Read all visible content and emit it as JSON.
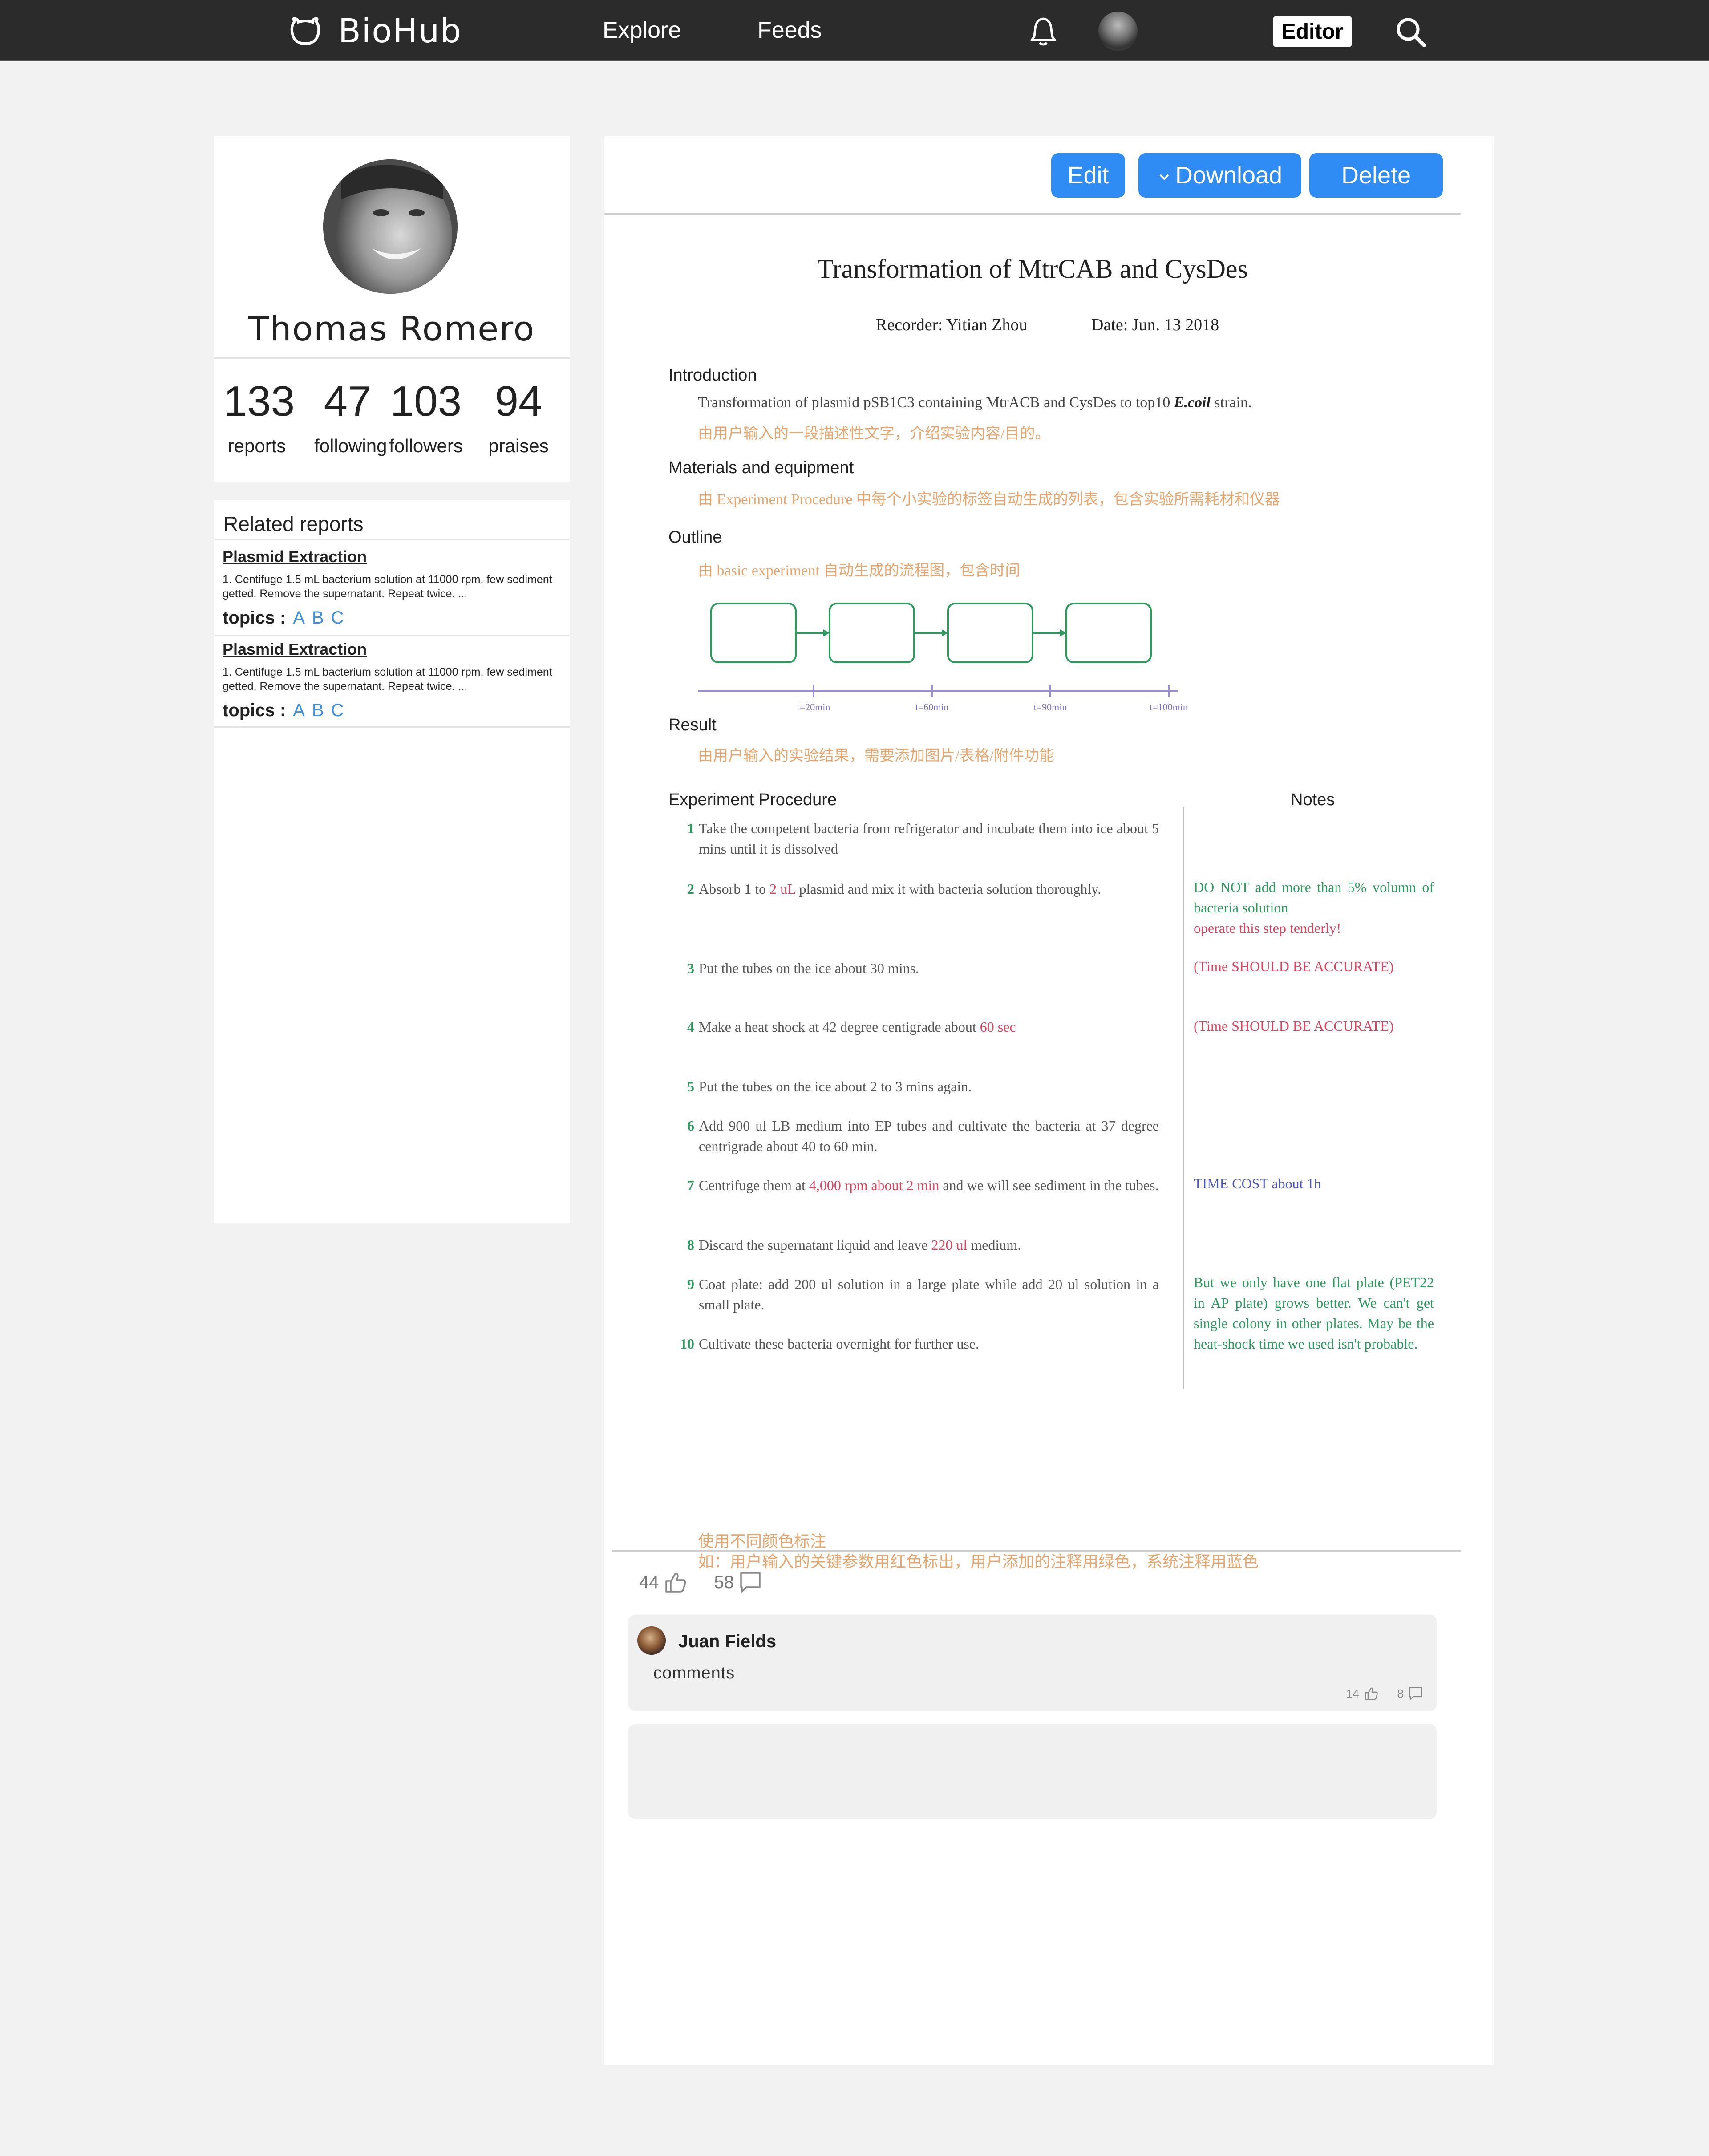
{
  "nav": {
    "brand": "BioHub",
    "explore": "Explore",
    "feeds": "Feeds",
    "editor": "Editor"
  },
  "profile": {
    "name": "Thomas Romero",
    "stats": [
      {
        "value": "133",
        "label": "reports"
      },
      {
        "value": "47",
        "label": "following"
      },
      {
        "value": "103",
        "label": "followers"
      },
      {
        "value": "94",
        "label": "praises"
      }
    ]
  },
  "related": {
    "title": "Related reports",
    "items": [
      {
        "title": "Plasmid Extraction",
        "desc": "1. Centifuge 1.5 mL bacterium solution at 11000 rpm, few sediment getted. Remove the supernatant. Repeat twice. ...",
        "topics_label": "topics :",
        "tags": [
          "A",
          "B",
          "C"
        ]
      },
      {
        "title": "Plasmid Extraction",
        "desc": "1. Centifuge 1.5 mL bacterium solution at 11000 rpm, few sediment getted. Remove the supernatant. Repeat twice. ...",
        "topics_label": "topics :",
        "tags": [
          "A",
          "B",
          "C"
        ]
      }
    ]
  },
  "toolbar": {
    "edit": "Edit",
    "download": "Download",
    "delete": "Delete"
  },
  "doc": {
    "title": "Transformation of MtrCAB and CysDes",
    "recorder": "Recorder: Yitian Zhou",
    "date": "Date: Jun. 13 2018",
    "introduction": {
      "heading": "Introduction",
      "text_prefix": "Transformation of plasmid pSB1C3 containing MtrACB and CysDes to top10 ",
      "text_italic": "E.coil",
      "text_suffix": " strain.",
      "hint": "由用户输入的一段描述性文字，介绍实验内容/目的。"
    },
    "materials": {
      "heading": "Materials and equipment",
      "hint": "由 Experiment Procedure 中每个小实验的标签自动生成的列表，包含实验所需耗材和仪器"
    },
    "outline": {
      "heading": "Outline",
      "hint": "由 basic experiment 自动生成的流程图，包含时间",
      "ticks": [
        "t=20min",
        "t=60min",
        "t=90min",
        "t=100min"
      ]
    },
    "result": {
      "heading": "Result",
      "hint": "由用户输入的实验结果，需要添加图片/表格/附件功能"
    },
    "procedure_heading": "Experiment Procedure",
    "notes_heading": "Notes",
    "steps": [
      {
        "num": "1",
        "text": "Take the competent bacteria from refrigerator and incubate them into ice about 5 mins until it is dissolved"
      },
      {
        "num": "2",
        "pre": "Absorb 1 to ",
        "hl": "2 uL",
        "post": " plasmid and mix it with bacteria solution thoroughly."
      },
      {
        "num": "3",
        "text": "Put the tubes on the ice about 30 mins."
      },
      {
        "num": "4",
        "pre": "Make a heat shock at 42 degree centigrade about ",
        "hl": "60 sec",
        "post": ""
      },
      {
        "num": "5",
        "text": "Put the tubes on the ice about 2 to 3 mins again."
      },
      {
        "num": "6",
        "text": "Add 900 ul LB medium into EP tubes and cultivate the bacteria at 37 degree centrigrade about 40 to 60 min."
      },
      {
        "num": "7",
        "pre": "Centrifuge them at ",
        "hl": "4,000 rpm about 2 min",
        "post": " and we will see sediment in the tubes."
      },
      {
        "num": "8",
        "pre": "Discard the supernatant liquid and leave ",
        "hl": "220 ul",
        "post": " medium."
      },
      {
        "num": "9",
        "text": "Coat plate: add 200 ul solution in a large plate while add 20 ul solution in a small plate."
      },
      {
        "num": "10",
        "text": "Cultivate these bacteria overnight for further use."
      }
    ],
    "notes": {
      "n2_green": "DO NOT add more than 5% volumn of bacteria solution",
      "n2_red": "operate this step tenderly!",
      "n3": "(Time SHOULD BE ACCURATE)",
      "n4": "(Time SHOULD BE ACCURATE)",
      "n7": "TIME COST about 1h",
      "n9": "But we only have one flat plate (PET22 in AP plate) grows better. We can't get single colony in other plates. May be the heat-shock time we used isn't probable."
    },
    "footnote_line1": "使用不同颜色标注",
    "footnote_line2": "如：用户输入的关键参数用红色标出，用户添加的注释用绿色，系统注释用蓝色"
  },
  "reactions": {
    "likes": "44",
    "comments": "58"
  },
  "comments": [
    {
      "user": "Juan Fields",
      "text": "comments",
      "likes": "14",
      "replies": "8"
    }
  ],
  "colors": {
    "accent": "#2f8cf5",
    "topbar": "#2b2b2b",
    "hint_orange": "#e8a56b",
    "param_red": "#e0415b",
    "note_green": "#2c9a5c",
    "system_blue": "#4a57b8"
  }
}
